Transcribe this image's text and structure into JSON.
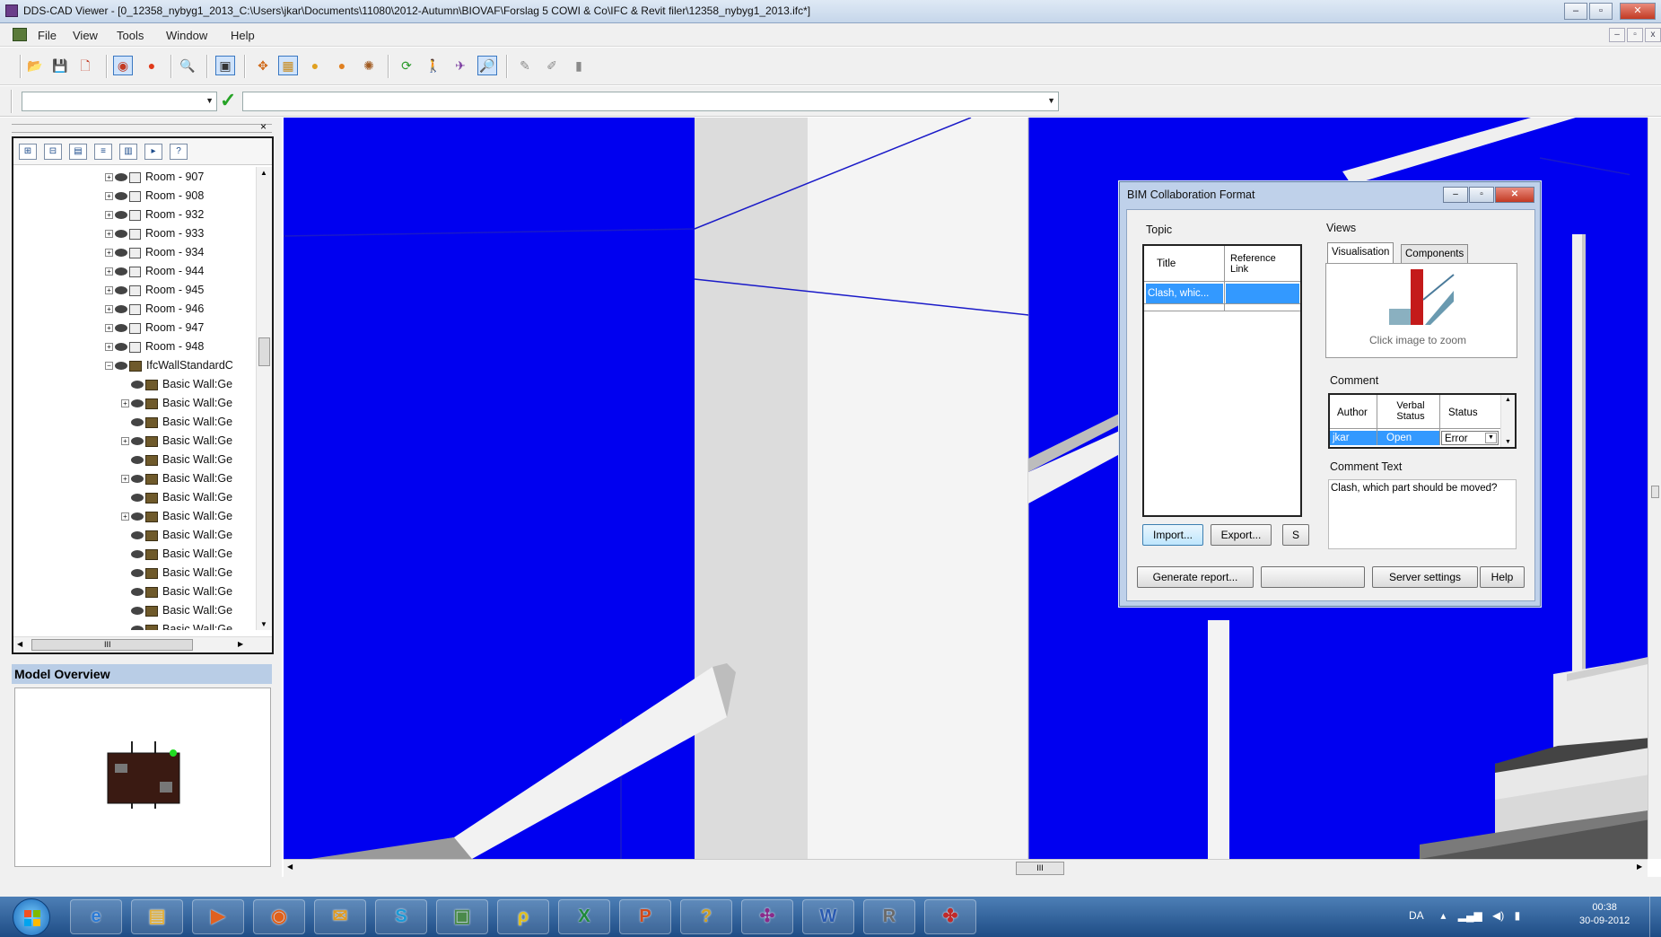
{
  "window": {
    "title": "DDS-CAD Viewer - [0_12358_nybyg1_2013_C:\\Users\\jkar\\Documents\\11080\\2012-Autumn\\BIOVAF\\Forslag 5 COWI & Co\\IFC & Revit filer\\12358_nybyg1_2013.ifc*]",
    "controls": {
      "minimize": "–",
      "maximize": "▫",
      "close": "✕"
    }
  },
  "menu": {
    "items": [
      "File",
      "View",
      "Tools",
      "Window",
      "Help"
    ],
    "mdi_controls": {
      "minimize": "–",
      "restore": "▫",
      "close": "x"
    }
  },
  "toolbar": {
    "buttons": [
      {
        "icon": "open-folder-icon",
        "glyph": "📂"
      },
      {
        "icon": "save-icon",
        "glyph": "💾"
      },
      {
        "icon": "bcf-icon",
        "glyph": "🗋"
      },
      {
        "icon": "select-icon",
        "glyph": "◉"
      },
      {
        "icon": "record-icon",
        "glyph": "●"
      },
      {
        "icon": "view-icon",
        "glyph": "🔍"
      },
      {
        "icon": "clip-icon",
        "glyph": "▣"
      },
      {
        "icon": "pan-icon",
        "glyph": "✥"
      },
      {
        "icon": "model-icon",
        "glyph": "▦"
      },
      {
        "icon": "sphere-icon",
        "glyph": "●"
      },
      {
        "icon": "sphere2-icon",
        "glyph": "●"
      },
      {
        "icon": "walk-icon",
        "glyph": "✺"
      },
      {
        "icon": "refresh-icon",
        "glyph": "⟳"
      },
      {
        "icon": "person-icon",
        "glyph": "🚶"
      },
      {
        "icon": "fly-icon",
        "glyph": "✈"
      },
      {
        "icon": "zoom-icon",
        "glyph": "🔎"
      },
      {
        "icon": "measure-icon",
        "glyph": "✎"
      },
      {
        "icon": "measure2-icon",
        "glyph": "✐"
      },
      {
        "icon": "grid-icon",
        "glyph": "▮"
      }
    ]
  },
  "command_bar": {
    "combo1_value": "",
    "combo2_value": "",
    "confirm_glyph": "✓"
  },
  "tree": {
    "toolbar_glyphs": [
      "⊞",
      "⊟",
      "▤",
      "≡",
      "▥",
      "▸",
      "?"
    ],
    "close_glyph": "×",
    "items": [
      {
        "label": "Room - 907",
        "kind": "room",
        "expander": "+"
      },
      {
        "label": "Room - 908",
        "kind": "room",
        "expander": "+"
      },
      {
        "label": "Room - 932",
        "kind": "room",
        "expander": "+"
      },
      {
        "label": "Room - 933",
        "kind": "room",
        "expander": "+"
      },
      {
        "label": "Room - 934",
        "kind": "room",
        "expander": "+"
      },
      {
        "label": "Room - 944",
        "kind": "room",
        "expander": "+"
      },
      {
        "label": "Room - 945",
        "kind": "room",
        "expander": "+"
      },
      {
        "label": "Room - 946",
        "kind": "room",
        "expander": "+"
      },
      {
        "label": "Room - 947",
        "kind": "room",
        "expander": "+"
      },
      {
        "label": "Room - 948",
        "kind": "room",
        "expander": "+"
      },
      {
        "label": "IfcWallStandardC",
        "kind": "wallgroup",
        "expander": "−"
      },
      {
        "label": "Basic Wall:Ge",
        "kind": "wall",
        "expander": ""
      },
      {
        "label": "Basic Wall:Ge",
        "kind": "wall",
        "expander": "+"
      },
      {
        "label": "Basic Wall:Ge",
        "kind": "wall",
        "expander": ""
      },
      {
        "label": "Basic Wall:Ge",
        "kind": "wall",
        "expander": "+"
      },
      {
        "label": "Basic Wall:Ge",
        "kind": "wall",
        "expander": ""
      },
      {
        "label": "Basic Wall:Ge",
        "kind": "wall",
        "expander": "+"
      },
      {
        "label": "Basic Wall:Ge",
        "kind": "wall",
        "expander": ""
      },
      {
        "label": "Basic Wall:Ge",
        "kind": "wall",
        "expander": "+"
      },
      {
        "label": "Basic Wall:Ge",
        "kind": "wall",
        "expander": ""
      },
      {
        "label": "Basic Wall:Ge",
        "kind": "wall",
        "expander": ""
      },
      {
        "label": "Basic Wall:Ge",
        "kind": "wall",
        "expander": ""
      },
      {
        "label": "Basic Wall:Ge",
        "kind": "wall",
        "expander": ""
      },
      {
        "label": "Basic Wall:Ge",
        "kind": "wall",
        "expander": ""
      },
      {
        "label": "Basic Wall:Ge",
        "kind": "wall",
        "expander": ""
      }
    ],
    "scroll_glyph": "III"
  },
  "model_overview": {
    "title": "Model Overview"
  },
  "bcf_dialog": {
    "title": "BIM Collaboration Format",
    "topic_label": "Topic",
    "topic_columns": [
      "Title",
      "Reference Link"
    ],
    "topic_rows": [
      {
        "title": "Clash, whic...",
        "link": ""
      }
    ],
    "views_label": "Views",
    "tabs": [
      "Visualisation",
      "Components"
    ],
    "click_to_zoom": "Click image to zoom",
    "comment_label": "Comment",
    "comment_columns": [
      "Author",
      "Verbal Status",
      "Status"
    ],
    "comment_rows": [
      {
        "author": "jkar",
        "verbal_status": "Open",
        "status": "Error"
      }
    ],
    "comment_text_label": "Comment Text",
    "comment_text": "Clash, which part should be moved?",
    "buttons": {
      "import": "Import...",
      "export": "Export...",
      "s": "S",
      "generate_report": "Generate report...",
      "blank": "",
      "server_settings": "Server settings",
      "help": "Help"
    }
  },
  "taskbar": {
    "apps": [
      {
        "icon": "ie-icon",
        "glyph": "e"
      },
      {
        "icon": "explorer-icon",
        "glyph": "▤"
      },
      {
        "icon": "media-icon",
        "glyph": "▶"
      },
      {
        "icon": "firefox-icon",
        "glyph": "◉"
      },
      {
        "icon": "outlook-icon",
        "glyph": "✉"
      },
      {
        "icon": "skype-icon",
        "glyph": "S"
      },
      {
        "icon": "monitor-icon",
        "glyph": "▣"
      },
      {
        "icon": "search-icon",
        "glyph": "ρ"
      },
      {
        "icon": "excel-icon",
        "glyph": "X"
      },
      {
        "icon": "powerpoint-icon",
        "glyph": "P"
      },
      {
        "icon": "help-icon",
        "glyph": "?"
      },
      {
        "icon": "ddscad-icon",
        "glyph": "✣"
      },
      {
        "icon": "word-icon",
        "glyph": "W"
      },
      {
        "icon": "revit-icon",
        "glyph": "R"
      },
      {
        "icon": "bcf-app-icon",
        "glyph": "✤"
      }
    ],
    "tray_lang": "DA",
    "clock_time": "00:38",
    "clock_date": "30-09-2012"
  }
}
